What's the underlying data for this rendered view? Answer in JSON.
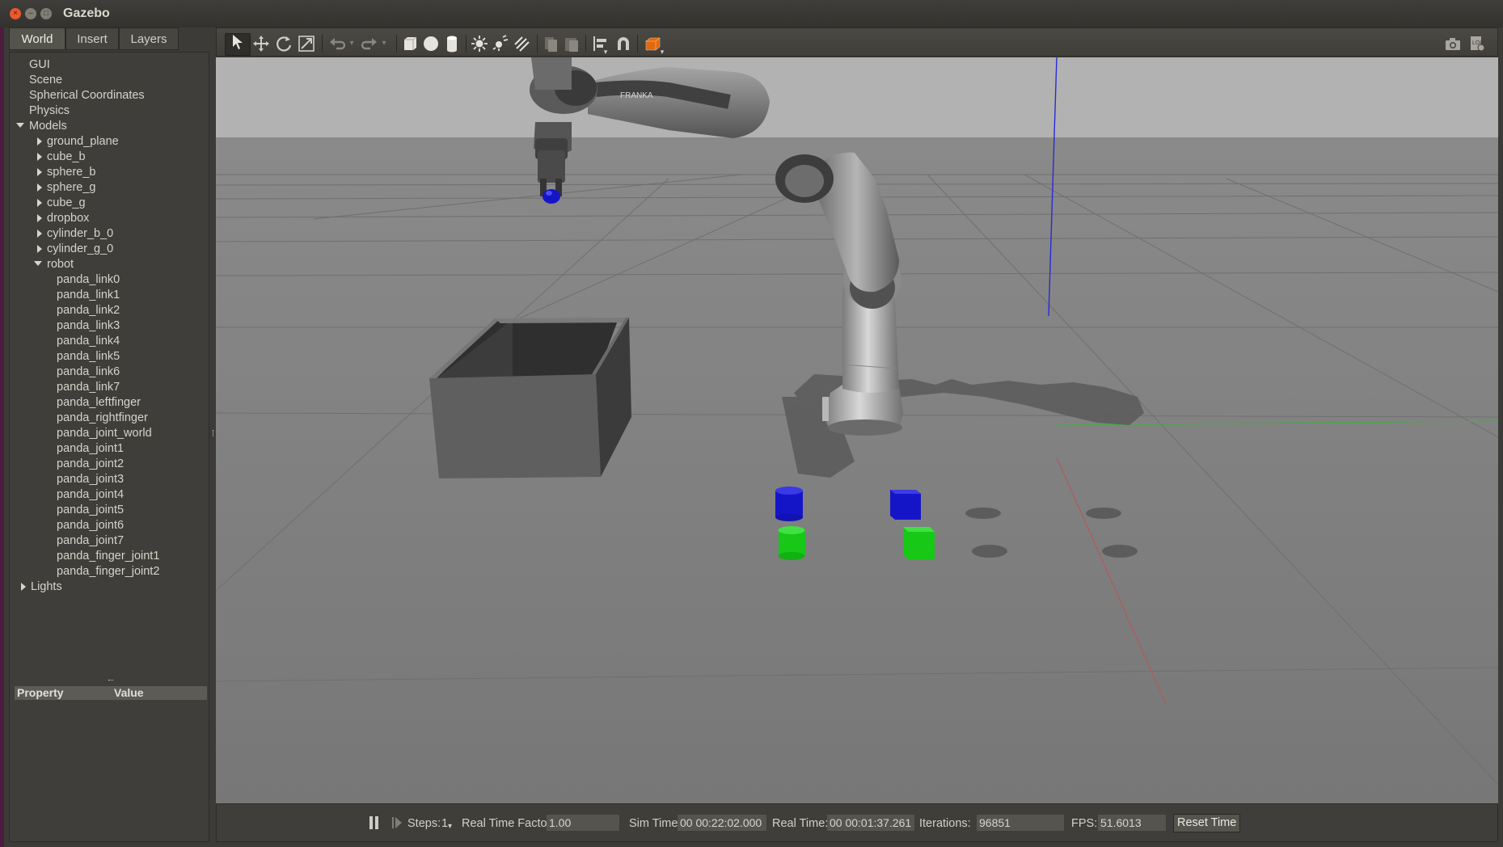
{
  "window": {
    "title": "Gazebo"
  },
  "tabs": [
    {
      "label": "World"
    },
    {
      "label": "Insert"
    },
    {
      "label": "Layers"
    }
  ],
  "tree": {
    "top": [
      "GUI",
      "Scene",
      "Spherical Coordinates",
      "Physics"
    ],
    "models_label": "Models",
    "models": [
      "ground_plane",
      "cube_b",
      "sphere_b",
      "sphere_g",
      "cube_g",
      "dropbox",
      "cylinder_b_0",
      "cylinder_g_0"
    ],
    "robot_label": "robot",
    "robot_children": [
      "panda_link0",
      "panda_link1",
      "panda_link2",
      "panda_link3",
      "panda_link4",
      "panda_link5",
      "panda_link6",
      "panda_link7",
      "panda_leftfinger",
      "panda_rightfinger",
      "panda_joint_world",
      "panda_joint1",
      "panda_joint2",
      "panda_joint3",
      "panda_joint4",
      "panda_joint5",
      "panda_joint6",
      "panda_joint7",
      "panda_finger_joint1",
      "panda_finger_joint2"
    ],
    "lights_label": "Lights"
  },
  "properties": {
    "col_property": "Property",
    "col_value": "Value"
  },
  "scene": {
    "robot_brand": "FRANKA"
  },
  "status": {
    "steps_label": "Steps:",
    "steps_value": "1",
    "rtf_label": "Real Time Factor:",
    "rtf_value": "1.00",
    "sim_time_label": "Sim Time:",
    "sim_time_value": "00 00:22:02.000",
    "real_time_label": "Real Time:",
    "real_time_value": "00 00:01:37.261",
    "iterations_label": "Iterations:",
    "iterations_value": "96851",
    "fps_label": "FPS:",
    "fps_value": "51.6013",
    "reset_label": "Reset Time"
  },
  "colors": {
    "blue_object": "#1515c8",
    "green_object": "#17c817",
    "sky": "#b4b4b4",
    "ground": "#7e7e7e"
  }
}
